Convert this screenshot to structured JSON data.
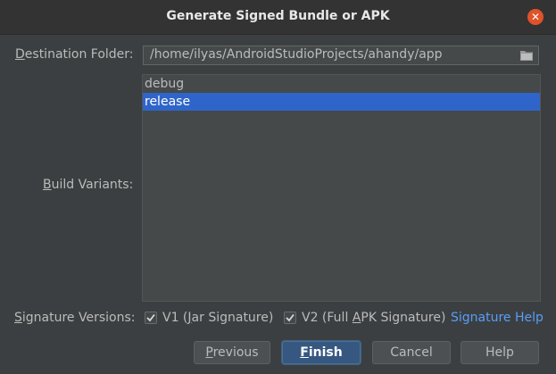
{
  "dialog": {
    "title": "Generate Signed Bundle or APK",
    "close_icon": "close-icon",
    "accent_color": "#2f65ca",
    "link_color": "#589df6"
  },
  "destination": {
    "label_first": "D",
    "label_rest": "estination Folder:",
    "path": "/home/ilyas/AndroidStudioProjects/ahandy/app",
    "browse_icon": "folder-icon"
  },
  "build_variants": {
    "label_first": "B",
    "label_rest": "uild Variants:",
    "items": [
      {
        "label": "debug",
        "selected": false
      },
      {
        "label": "release",
        "selected": true
      }
    ]
  },
  "signature": {
    "label_first": "S",
    "label_rest": "ignature Versions:",
    "v1": {
      "pre": "V1 (",
      "mnemonic": "J",
      "post": "ar Signature)",
      "checked": true
    },
    "v2": {
      "pre": "V2 (Full ",
      "mnemonic": "A",
      "post": "PK Signature)",
      "checked": true
    },
    "help_link": "Signature Help"
  },
  "buttons": {
    "previous": {
      "mnemonic": "P",
      "rest": "revious"
    },
    "finish": {
      "mnemonic": "F",
      "rest": "inish"
    },
    "cancel": "Cancel",
    "help": "Help"
  }
}
